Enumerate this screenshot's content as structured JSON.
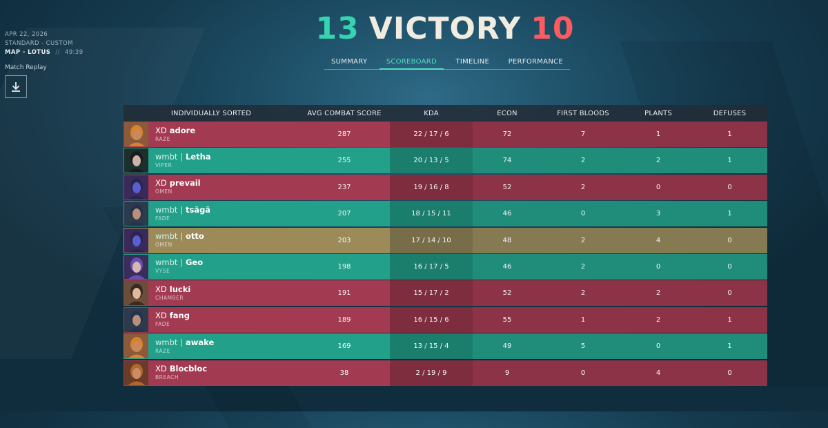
{
  "meta": {
    "date": "APR 22, 2026",
    "mode": "STANDARD - CUSTOM",
    "map": "MAP - LOTUS",
    "separator": "//",
    "duration": "49:39"
  },
  "replay": {
    "label": "Match Replay",
    "icon": "download-icon"
  },
  "header": {
    "score_team": "13",
    "result": "VICTORY",
    "score_enemy": "10",
    "colors": {
      "team": "#35d3b0",
      "enemy": "#ff5a5f",
      "result": "#f2ece0"
    }
  },
  "tabs": [
    {
      "label": "SUMMARY",
      "active": false
    },
    {
      "label": "SCOREBOARD",
      "active": true
    },
    {
      "label": "TIMELINE",
      "active": false
    },
    {
      "label": "PERFORMANCE",
      "active": false
    }
  ],
  "columns": [
    "INDIVIDUALLY SORTED",
    "AVG COMBAT SCORE",
    "KDA",
    "ECON",
    "FIRST BLOODS",
    "PLANTS",
    "DEFUSES"
  ],
  "rows": [
    {
      "team_tag": "XD",
      "name": "adore",
      "agent": "RAZE",
      "acs": "287",
      "kda": "22 / 17 / 6",
      "econ": "72",
      "fb": "7",
      "plants": "1",
      "defuses": "1",
      "side": "red",
      "avatar": {
        "bg": "#8a5a3a",
        "hair": "#d9822b",
        "skin": "#c68a5e"
      }
    },
    {
      "team_tag": "wmbt |",
      "name": "Letha",
      "agent": "VIPER",
      "acs": "255",
      "kda": "20 / 13 / 5",
      "econ": "74",
      "fb": "2",
      "plants": "2",
      "defuses": "1",
      "side": "green",
      "avatar": {
        "bg": "#1c2f2b",
        "hair": "#1b1b1f",
        "skin": "#c9b4a6"
      }
    },
    {
      "team_tag": "XD",
      "name": "prevail",
      "agent": "OMEN",
      "acs": "237",
      "kda": "19 / 16 / 8",
      "econ": "52",
      "fb": "2",
      "plants": "0",
      "defuses": "0",
      "side": "red",
      "avatar": {
        "bg": "#3a2a5a",
        "hair": "#2b2350",
        "skin": "#5a5fd0"
      }
    },
    {
      "team_tag": "wmbt |",
      "name": "tsägä",
      "agent": "FADE",
      "acs": "207",
      "kda": "18 / 15 / 11",
      "econ": "46",
      "fb": "0",
      "plants": "3",
      "defuses": "1",
      "side": "green",
      "avatar": {
        "bg": "#2b3b4d",
        "hair": "#26324a",
        "skin": "#b88f7a"
      }
    },
    {
      "team_tag": "wmbt |",
      "name": "otto",
      "agent": "OMEN",
      "acs": "203",
      "kda": "17 / 14 / 10",
      "econ": "48",
      "fb": "2",
      "plants": "4",
      "defuses": "0",
      "side": "gold",
      "avatar": {
        "bg": "#3a2a5a",
        "hair": "#2b2350",
        "skin": "#5a5fd0"
      }
    },
    {
      "team_tag": "wmbt |",
      "name": "Geo",
      "agent": "VYSE",
      "acs": "198",
      "kda": "16 / 17 / 5",
      "econ": "46",
      "fb": "2",
      "plants": "0",
      "defuses": "0",
      "side": "green",
      "avatar": {
        "bg": "#3b2d5b",
        "hair": "#6a4fb0",
        "skin": "#d7b7b0"
      }
    },
    {
      "team_tag": "XD",
      "name": "lucki",
      "agent": "CHAMBER",
      "acs": "191",
      "kda": "15 / 17 / 2",
      "econ": "52",
      "fb": "2",
      "plants": "2",
      "defuses": "0",
      "side": "red",
      "avatar": {
        "bg": "#6a4e3a",
        "hair": "#3a2a22",
        "skin": "#e0b99a"
      }
    },
    {
      "team_tag": "XD",
      "name": "fang",
      "agent": "FADE",
      "acs": "189",
      "kda": "16 / 15 / 6",
      "econ": "55",
      "fb": "1",
      "plants": "2",
      "defuses": "1",
      "side": "red",
      "avatar": {
        "bg": "#2b3b4d",
        "hair": "#26324a",
        "skin": "#b88f7a"
      }
    },
    {
      "team_tag": "wmbt |",
      "name": "awake",
      "agent": "RAZE",
      "acs": "169",
      "kda": "13 / 15 / 4",
      "econ": "49",
      "fb": "5",
      "plants": "0",
      "defuses": "1",
      "side": "green",
      "avatar": {
        "bg": "#8a5a3a",
        "hair": "#d9822b",
        "skin": "#c68a5e"
      }
    },
    {
      "team_tag": "XD",
      "name": "Blocbloc",
      "agent": "BREACH",
      "acs": "38",
      "kda": "2 / 19 / 9",
      "econ": "9",
      "fb": "0",
      "plants": "4",
      "defuses": "0",
      "side": "red",
      "avatar": {
        "bg": "#6b3b2a",
        "hair": "#b5652e",
        "skin": "#c98e68"
      }
    }
  ]
}
